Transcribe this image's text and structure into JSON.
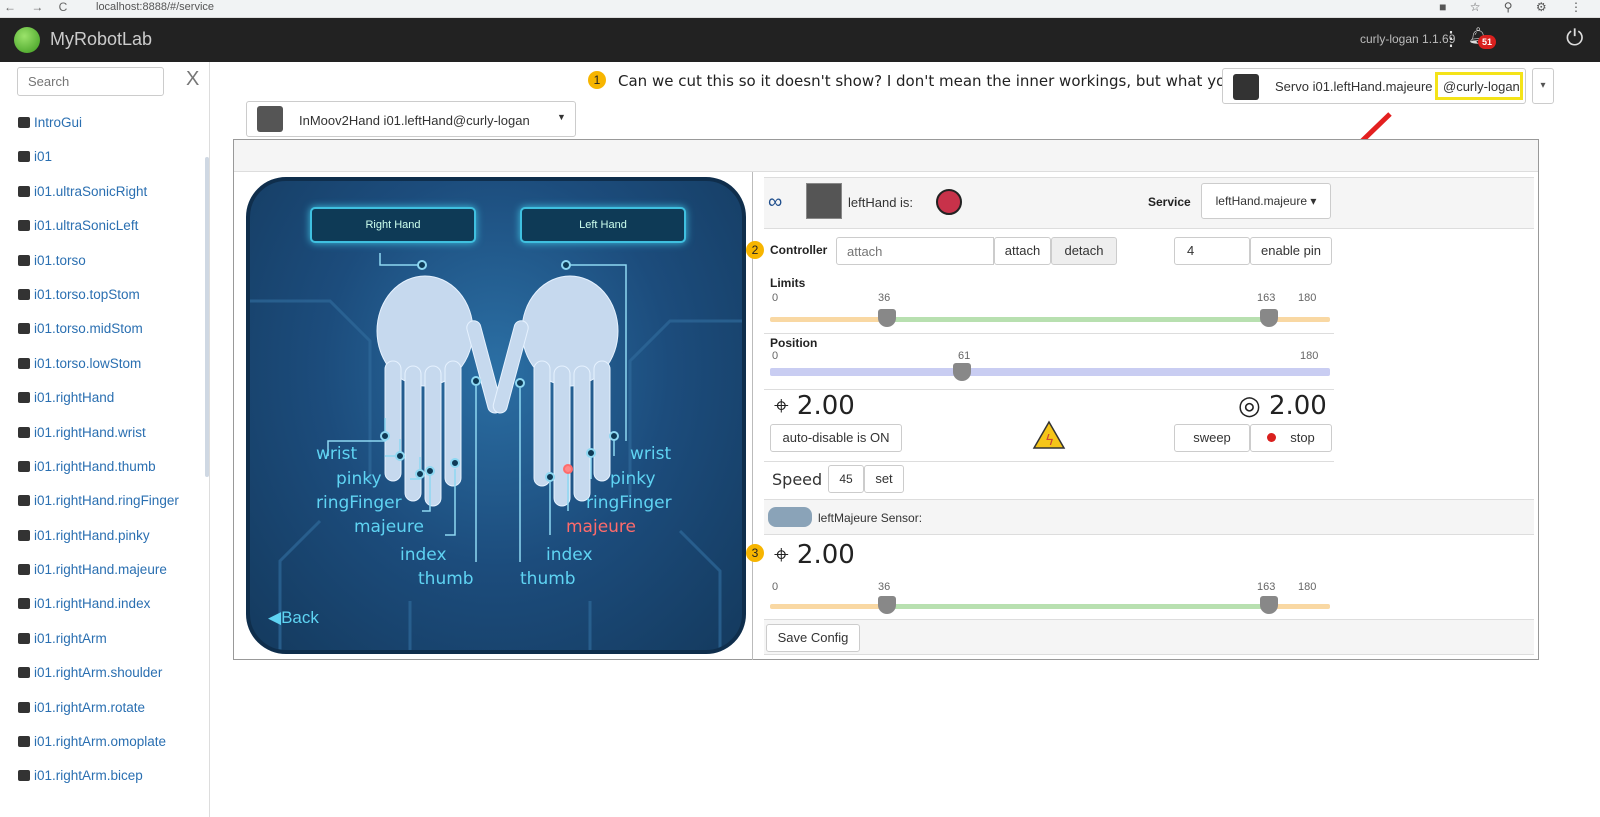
{
  "browser": {
    "nav_glyphs": "← → C",
    "url": "localhost:8888/#/service",
    "ext_glyphs": "■ ☆ ⚲ ⚙ ⋮"
  },
  "navbar": {
    "brand": "MyRobotLab",
    "version": "curly-logan 1.1.69",
    "notification_count": "51"
  },
  "sidebar": {
    "search_placeholder": "Search",
    "clear_label": "X",
    "items": [
      "IntroGui",
      "i01",
      "i01.ultraSonicRight",
      "i01.ultraSonicLeft",
      "i01.torso",
      "i01.torso.topStom",
      "i01.torso.midStom",
      "i01.torso.lowStom",
      "i01.rightHand",
      "i01.rightHand.wrist",
      "i01.rightHand.thumb",
      "i01.rightHand.ringFinger",
      "i01.rightHand.pinky",
      "i01.rightHand.majeure",
      "i01.rightHand.index",
      "i01.rightArm",
      "i01.rightArm.shoulder",
      "i01.rightArm.rotate",
      "i01.rightArm.omoplate",
      "i01.rightArm.bicep"
    ]
  },
  "annotations": {
    "n1": "1",
    "n2": "2",
    "n3": "3",
    "text": "Can we cut this so it doesn't show? I don't mean the inner workings, but what you see."
  },
  "service_selector": {
    "label": "Servo  i01.leftHand.majeure",
    "highlight": "@curly-logan"
  },
  "hand_selector": {
    "label": "InMoov2Hand  i01.leftHand@curly-logan"
  },
  "hand_graphic": {
    "right_tab": "Right Hand",
    "left_tab": "Left Hand",
    "right_labels": {
      "wrist": "wrist",
      "pinky": "pinky",
      "ringFinger": "ringFinger",
      "majeure": "majeure",
      "index": "index",
      "thumb": "thumb"
    },
    "left_labels": {
      "wrist": "wrist",
      "pinky": "pinky",
      "ringFinger": "ringFinger",
      "majeure": "majeure",
      "index": "index",
      "thumb": "thumb"
    },
    "back": "◀Back"
  },
  "servo": {
    "is_label": "leftHand is:",
    "service_label": "Service",
    "service_value": "leftHand.majeure",
    "controller_label": "Controller",
    "controller_placeholder": "attach",
    "attach_btn": "attach",
    "detach_btn": "detach",
    "pin_value": "4",
    "enable_pin_btn": "enable pin",
    "limits_label": "Limits",
    "limits": {
      "min": "0",
      "low": "36",
      "high": "163",
      "max": "180"
    },
    "position_label": "Position",
    "position": {
      "min": "0",
      "value": "61",
      "max": "180"
    },
    "current_pos": "2.00",
    "target_pos": "2.00",
    "auto_disable_btn": "auto-disable is ON",
    "sweep_btn": "sweep",
    "stop_btn": "stop",
    "speed_label": "Speed",
    "speed_value": "45",
    "set_btn": "set",
    "sensor_label": "leftMajeure Sensor:",
    "sensor_pos": "2.00",
    "sensor_limits": {
      "min": "0",
      "low": "36",
      "high": "163",
      "max": "180"
    },
    "save_btn": "Save Config"
  },
  "colors": {
    "navbar_bg": "#222222",
    "link_blue": "#2a6fb1",
    "annotation_yellow": "#f7b500",
    "highlight_yellow": "#f4e318",
    "arrow_red": "#e32020",
    "status_red": "#c8324a",
    "limit_track_orange": "#f9d8a3",
    "limit_track_green": "#b8e0b0",
    "position_track": "#c9cdf2",
    "hand_label_cyan": "#5fd4f3"
  }
}
